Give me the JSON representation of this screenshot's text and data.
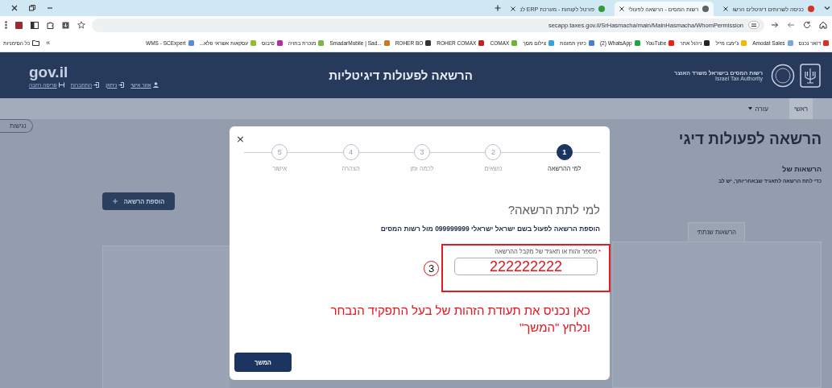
{
  "browser": {
    "tabs": [
      {
        "label": "כניסה לשרותים דיגיטלים הרשו",
        "selected": false,
        "color": "#d93025"
      },
      {
        "label": "רשות המסים - הרשאה לפעולי",
        "selected": true,
        "color": "#5f6368"
      },
      {
        "label": "פורטל לקוחות - מערכת ERP לנ",
        "selected": false,
        "color": "#2e9c3a"
      }
    ],
    "url": "secapp.taxes.gov.il/SrHasmacha/main/MainHasmacha/WhomPermission",
    "bookmarks": [
      {
        "label": "דואר נכנס",
        "color": "#d93025"
      },
      {
        "label": "Amodat Sales",
        "color": "#7aa7d8"
      },
      {
        "label": "ג'ימבו מייל",
        "color": "#f2b705"
      },
      {
        "label": "ניהול אתר",
        "color": "#222222"
      },
      {
        "label": "YouTube",
        "color": "#e62117"
      },
      {
        "label": "(2) WhatsApp",
        "color": "#25a244"
      },
      {
        "label": "כיווץ תמונות",
        "color": "#4a7fd0"
      },
      {
        "label": "צילום מסך",
        "color": "#3aa0e0"
      },
      {
        "label": "COMAX",
        "color": "#6bb535"
      },
      {
        "label": "ROHER COMAX",
        "color": "#b3262b"
      },
      {
        "label": "ROHER BO",
        "color": "#333333"
      },
      {
        "label": "SmadarMobile | Sad...",
        "color": "#c77b2a"
      },
      {
        "label": "מוכרת בחויה",
        "color": "#7ab648"
      },
      {
        "label": "סיבוס",
        "color": "#b0309a"
      },
      {
        "label": "עסקאות אשראי פלא...",
        "color": "#8fbf2f"
      },
      {
        "label": "WMS - SCExpert",
        "color": "#5a8bd6"
      }
    ],
    "overflow": "»",
    "all_bookmarks": "כל הסימניות"
  },
  "site": {
    "logo": "gov.il",
    "links": [
      "אזור אישי",
      "ניתוק",
      "התחברות",
      "פריסה רחבה"
    ],
    "title": "הרשאה לפעולות דיגיטליות",
    "authority_he": "רשות המסים בישראל משרד האוצר",
    "authority_en": "Israel Tax Authority",
    "nav": [
      {
        "label": "ראשי",
        "selected": true,
        "dropdown": false
      },
      {
        "label": "עזרה",
        "selected": false,
        "dropdown": true
      }
    ],
    "accessibility": "נגישות"
  },
  "page": {
    "title": "הרשאה לפעולות דיגי",
    "subtitle": "הרשאות של",
    "note": "כדי לתת הרשאה לתאגיד שבאחריותך, יש לב",
    "tab": "הרשאות שנתתי",
    "add_button": "הוספת הרשאה"
  },
  "modal": {
    "close": "×",
    "steps": [
      {
        "number": "1",
        "label": "למי ההרשאה",
        "selected": true
      },
      {
        "number": "2",
        "label": "נושאים",
        "selected": false
      },
      {
        "number": "3",
        "label": "לכמה זמן",
        "selected": false
      },
      {
        "number": "4",
        "label": "הצהרה",
        "selected": false
      },
      {
        "number": "5",
        "label": "אישור",
        "selected": false
      }
    ],
    "heading": "למי לתת הרשאה?",
    "sentence": "הוספת הרשאה לפעול בשם  ישראל ישראלי 099999999 מול רשות המסים",
    "field": {
      "required_mark": "*",
      "label": "מספר זהות או תאגיד של מקבל ההרשאה",
      "value": "222222222"
    },
    "annotation": {
      "marker": "3",
      "note": "כאן נכניס את תעודת הזהות של בעל התפקיד הנבחר\nונלחץ \"המשך\""
    },
    "button": "המשך"
  }
}
